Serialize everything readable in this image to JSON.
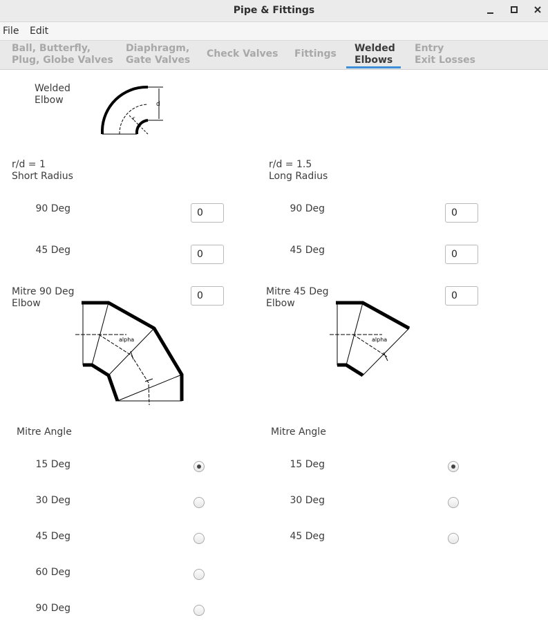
{
  "window": {
    "title": "Pipe & Fittings",
    "minimize_glyph": "–",
    "maximize_glyph": "□",
    "close_glyph": "✕"
  },
  "menu": [
    "File",
    "Edit"
  ],
  "tabs": [
    {
      "label": "Ball, Butterfly,\nPlug, Globe Valves",
      "active": false
    },
    {
      "label": "Diaphragm,\nGate Valves",
      "active": false
    },
    {
      "label": "Check Valves",
      "active": false
    },
    {
      "label": "Fittings",
      "active": false
    },
    {
      "label": "Welded\nElbows",
      "active": true
    },
    {
      "label": "Entry\nExit Losses",
      "active": false
    }
  ],
  "header": {
    "elbow_label": "Welded\nElbow",
    "diagram_d": "d",
    "diagram_r": "r"
  },
  "short_radius": {
    "heading": "r/d = 1\nShort Radius",
    "deg90_label": "90 Deg",
    "deg90_value": "0",
    "deg45_label": "45 Deg",
    "deg45_value": "0"
  },
  "long_radius": {
    "heading": "r/d = 1.5\nLong Radius",
    "deg90_label": "90 Deg",
    "deg90_value": "0",
    "deg45_label": "45 Deg",
    "deg45_value": "0"
  },
  "mitre90": {
    "label": "Mitre 90 Deg\nElbow",
    "value": "0",
    "alpha": "alpha",
    "angle_heading": "Mitre Angle",
    "options": [
      {
        "label": "15 Deg",
        "checked": true
      },
      {
        "label": "30 Deg",
        "checked": false
      },
      {
        "label": "45 Deg",
        "checked": false
      },
      {
        "label": "60 Deg",
        "checked": false
      },
      {
        "label": "90 Deg",
        "checked": false
      }
    ]
  },
  "mitre45": {
    "label": "Mitre 45 Deg\nElbow",
    "value": "0",
    "alpha": "alpha",
    "angle_heading": "Mitre Angle",
    "options": [
      {
        "label": "15 Deg",
        "checked": true
      },
      {
        "label": "30 Deg",
        "checked": false
      },
      {
        "label": "45 Deg",
        "checked": false
      }
    ]
  }
}
